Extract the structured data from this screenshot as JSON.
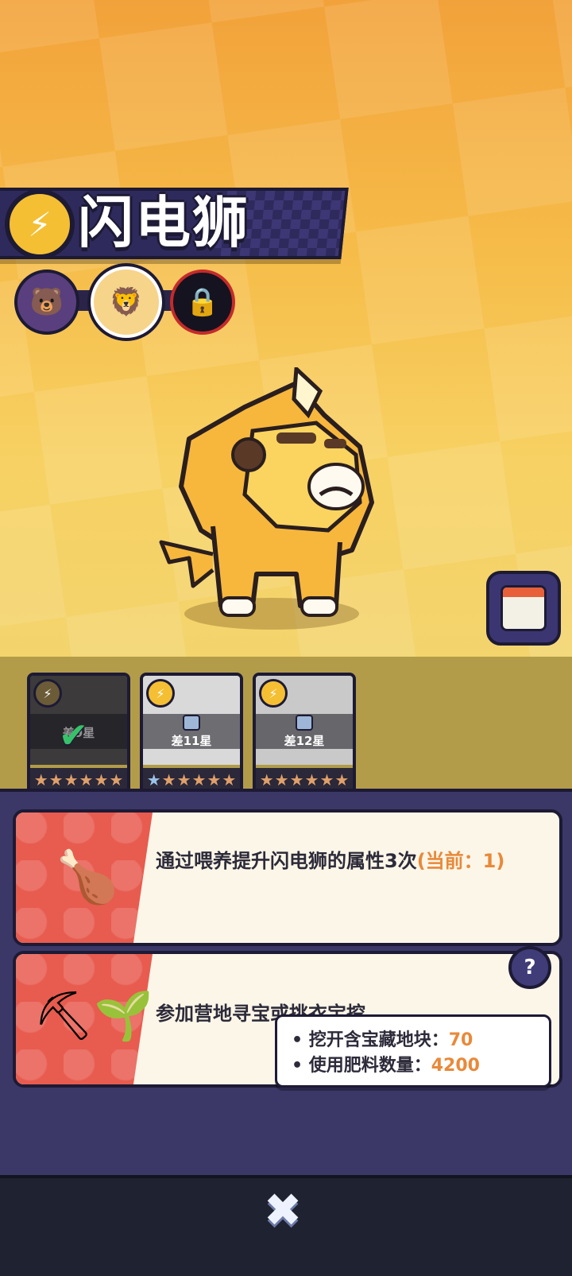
{
  "header": {
    "title": "闪电狮",
    "element_icon": "lightning-icon"
  },
  "evolution": [
    {
      "name": "bear-stage-icon",
      "locked": false
    },
    {
      "name": "lion-stage-icon",
      "locked": false,
      "selected": true
    },
    {
      "name": "locked-stage-icon",
      "locked": true
    }
  ],
  "skins": [
    {
      "lock_text": "差9星",
      "unlocked": true,
      "stars_blue": 0,
      "stars_total": 6
    },
    {
      "lock_text": "差11星",
      "unlocked": false,
      "stars_blue": 1,
      "stars_total": 6
    },
    {
      "lock_text": "差12星",
      "unlocked": false,
      "stars_blue": 0,
      "stars_total": 6
    }
  ],
  "tasks": [
    {
      "text": "通过喂养提升闪电狮的属性3次",
      "current": "(当前：1)",
      "icon": "drumstick-icon"
    },
    {
      "text": "参加营地寻宝或挑衣宝挖",
      "icon": "hammer-fertilizer-icon"
    }
  ],
  "tooltip": {
    "line1_label": "挖开含宝藏地块：",
    "line1_value": "70",
    "line2_label": "使用肥料数量：",
    "line2_value": "4200"
  },
  "help_label": "?",
  "close_label": "✖",
  "colors": {
    "accent": "#e9893a",
    "banner": "#2f2a5c",
    "task_icon_bg": "#e85b4f"
  }
}
